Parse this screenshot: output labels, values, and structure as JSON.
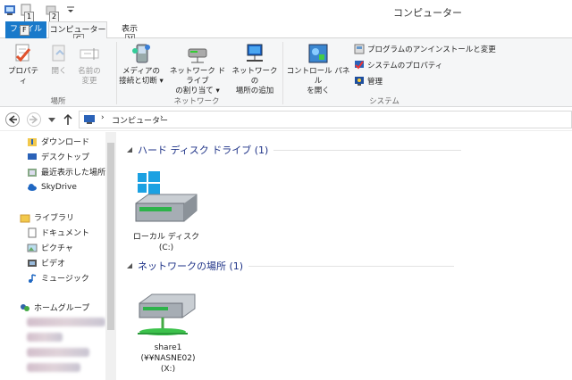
{
  "window": {
    "title": "コンピューター"
  },
  "qat": {
    "keytip1": "1",
    "keytip2": "2"
  },
  "tabs": {
    "file": {
      "label": "ファイル",
      "keytip": "F"
    },
    "computer": {
      "label": "コンピューター",
      "keytip": "C"
    },
    "view": {
      "label": "表示",
      "keytip": "V"
    }
  },
  "ribbon": {
    "location_group": "場所",
    "network_group": "ネットワーク",
    "system_group": "システム",
    "properties": "プロパティ",
    "open": "開く",
    "rename_1": "名前の",
    "rename_2": "変更",
    "media_1": "メディアの",
    "media_2": "接続と切断 ▾",
    "map_1": "ネットワーク ドライブ",
    "map_2": "の割り当て ▾",
    "addloc_1": "ネットワークの",
    "addloc_2": "場所の追加",
    "cp_1": "コントロール パネル",
    "cp_2": "を開く",
    "uninstall": "プログラムのアンインストールと変更",
    "sysprops": "システムのプロパティ",
    "manage": "管理"
  },
  "address": {
    "crumb": "コンピューター",
    "sep": "›"
  },
  "nav": {
    "downloads": "ダウンロード",
    "desktop": "デスクトップ",
    "recent": "最近表示した場所",
    "skydrive": "SkyDrive",
    "libraries": "ライブラリ",
    "documents": "ドキュメント",
    "pictures": "ピクチャ",
    "videos": "ビデオ",
    "music": "ミュージック",
    "homegroup": "ホームグループ"
  },
  "content": {
    "hdd_section": "ハード ディスク ドライブ (1)",
    "net_section": "ネットワークの場所 (1)",
    "local_disk_1": "ローカル ディスク",
    "local_disk_2": "(C:)",
    "share_1": "share1",
    "share_2": "(¥¥NASNE02)",
    "share_3": "(X:)"
  },
  "colors": {
    "accent": "#1979ca",
    "section": "#1e3287"
  }
}
